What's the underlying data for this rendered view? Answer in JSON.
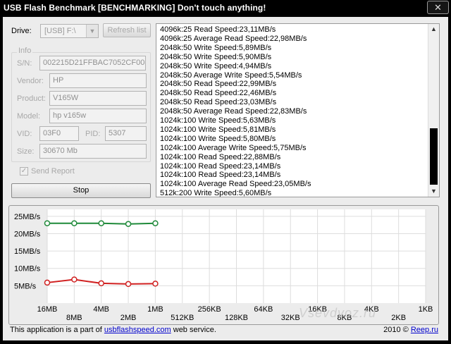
{
  "window": {
    "title": "USB Flash Benchmark [BENCHMARKING] Don't touch anything!",
    "close_glyph": "✕"
  },
  "drive": {
    "label": "Drive:",
    "selected": "[USB] F:\\",
    "refresh_label": "Refresh list"
  },
  "info": {
    "group_label": "Info",
    "sn_label": "S/N:",
    "sn_value": "002215D21FFBAC7052CF005",
    "vendor_label": "Vendor:",
    "vendor_value": "HP",
    "product_label": "Product:",
    "product_value": "V165W",
    "model_label": "Model:",
    "model_value": "hp v165w",
    "vid_label": "VID:",
    "vid_value": "03F0",
    "pid_label": "PID:",
    "pid_value": "5307",
    "size_label": "Size:",
    "size_value": "30670 Mb"
  },
  "send_report": {
    "label": "Send Report",
    "checked": true
  },
  "stop_label": "Stop",
  "log_lines": [
    "4096k:25 Read Speed:23,11MB/s",
    "4096k:25 Average Read Speed:22,98MB/s",
    "2048k:50 Write Speed:5,89MB/s",
    "2048k:50 Write Speed:5,90MB/s",
    "2048k:50 Write Speed:4,94MB/s",
    "2048k:50 Average Write Speed:5,54MB/s",
    "2048k:50 Read Speed:22,99MB/s",
    "2048k:50 Read Speed:22,46MB/s",
    "2048k:50 Read Speed:23,03MB/s",
    "2048k:50 Average Read Speed:22,83MB/s",
    "1024k:100 Write Speed:5,63MB/s",
    "1024k:100 Write Speed:5,81MB/s",
    "1024k:100 Write Speed:5,80MB/s",
    "1024k:100 Average Write Speed:5,75MB/s",
    "1024k:100 Read Speed:22,88MB/s",
    "1024k:100 Read Speed:23,14MB/s",
    "1024k:100 Read Speed:23,14MB/s",
    "1024k:100 Average Read Speed:23,05MB/s",
    "512k:200 Write Speed:5,60MB/s"
  ],
  "chart_data": {
    "type": "line",
    "categories": [
      "16MB",
      "8MB",
      "4MB",
      "2MB",
      "1MB",
      "512KB",
      "256KB",
      "128KB",
      "64KB",
      "32KB",
      "16KB",
      "8KB",
      "4KB",
      "2KB",
      "1KB"
    ],
    "y_ticks": [
      "25MB/s",
      "20MB/s",
      "15MB/s",
      "10MB/s",
      "5MB/s"
    ],
    "y_tick_values": [
      25,
      20,
      15,
      10,
      5
    ],
    "ylim": [
      0,
      27
    ],
    "grid": true,
    "series": [
      {
        "values": [
          23.0,
          23.0,
          23.0,
          22.8,
          23.0
        ],
        "color": "#1f8a3a"
      },
      {
        "values": [
          5.9,
          6.8,
          5.7,
          5.5,
          5.6
        ],
        "color": "#d02020"
      }
    ]
  },
  "footer": {
    "prefix": "This application is a part of ",
    "link": "usbflashspeed.com",
    "suffix": " web service.",
    "copyright_year": "2010 © ",
    "copyright_link": "Reep.ru"
  },
  "watermark": "Vsevdvoz.ru"
}
